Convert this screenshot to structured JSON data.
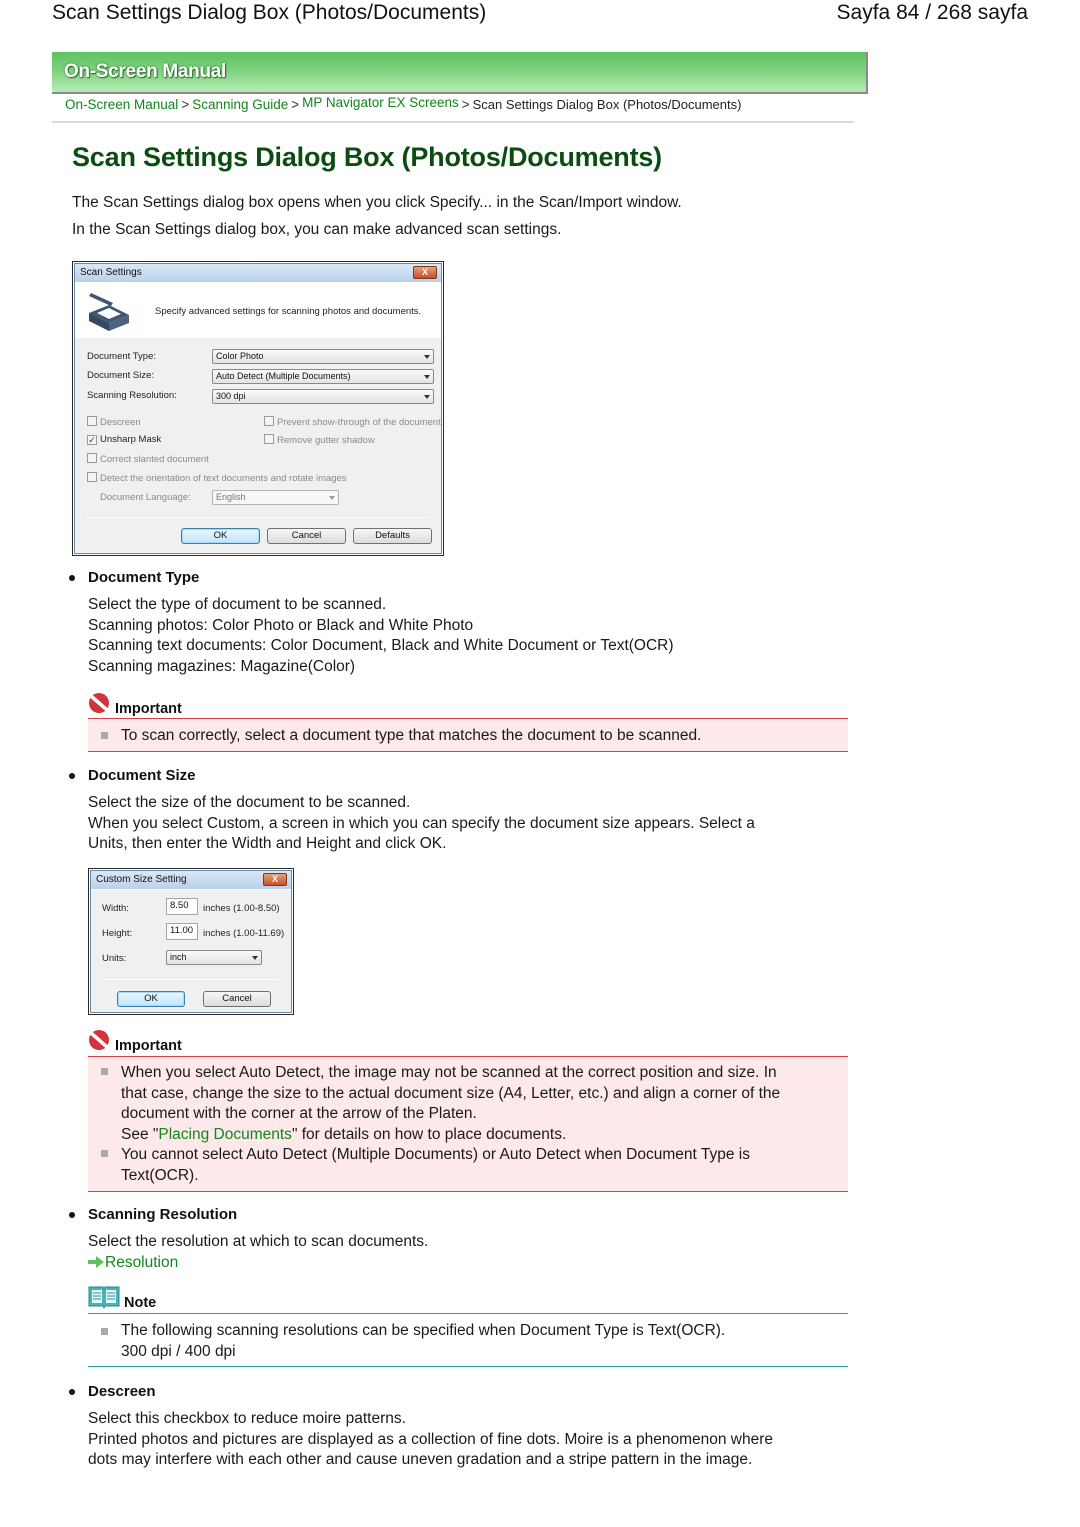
{
  "page_header": {
    "title": "Scan Settings Dialog Box (Photos/Documents)",
    "page_indicator": "Sayfa 84 / 268 sayfa"
  },
  "banner": {
    "label": "On-Screen Manual",
    "color": "#6bc96b"
  },
  "breadcrumb": {
    "items": [
      {
        "label": "On-Screen Manual",
        "link": true
      },
      {
        "label": "Scanning Guide",
        "link": true
      },
      {
        "label": "MP Navigator EX Screens",
        "link": true
      },
      {
        "label": "Scan Settings Dialog Box (Photos/Documents)",
        "link": false
      }
    ],
    "separator": ">"
  },
  "main": {
    "title": "Scan Settings Dialog Box (Photos/Documents)",
    "intro": [
      "The Scan Settings dialog box opens when you click Specify... in the Scan/Import window.",
      "In the Scan Settings dialog box, you can make advanced scan settings."
    ]
  },
  "scan_dialog": {
    "title": "Scan Settings",
    "close_label": "X",
    "description": "Specify advanced settings for scanning photos and documents.",
    "fields": [
      {
        "label": "Document Type:",
        "value": "Color Photo"
      },
      {
        "label": "Document Size:",
        "value": "Auto Detect (Multiple Documents)"
      },
      {
        "label": "Scanning Resolution:",
        "value": "300 dpi"
      }
    ],
    "checkboxes": [
      {
        "label": "Descreen",
        "checked": false,
        "mark": ""
      },
      {
        "label": "Prevent show-through of the document",
        "checked": false,
        "mark": ""
      },
      {
        "label": "Unsharp Mask",
        "checked": true,
        "mark": "✓"
      },
      {
        "label": "Remove gutter shadow",
        "checked": false,
        "mark": ""
      },
      {
        "label": "Correct slanted document",
        "checked": false,
        "mark": ""
      },
      {
        "label": "Detect the orientation of text documents and rotate images",
        "checked": false,
        "mark": ""
      }
    ],
    "language": {
      "label": "Document Language:",
      "value": "English"
    },
    "buttons": {
      "ok": "OK",
      "cancel": "Cancel",
      "defaults": "Defaults"
    }
  },
  "sections": {
    "document_type": {
      "heading": "Document Type",
      "lines": [
        "Select the type of document to be scanned.",
        "Scanning photos: Color Photo or Black and White Photo",
        "Scanning text documents: Color Document, Black and White Document or Text(OCR)",
        "Scanning magazines: Magazine(Color)"
      ],
      "important": {
        "title": "Important",
        "items": [
          "To scan correctly, select a document type that matches the document to be scanned."
        ]
      }
    },
    "document_size": {
      "heading": "Document Size",
      "lines": [
        "Select the size of the document to be scanned.",
        "When you select Custom, a screen in which you can specify the document size appears. Select a",
        "Units, then enter the Width and Height and click OK."
      ],
      "important": {
        "title": "Important",
        "item1_lines": [
          "When you select Auto Detect, the image may not be scanned at the correct position and size. In",
          "that case, change the size to the actual document size (A4, Letter, etc.) and align a corner of the",
          "document with the corner at the arrow of the Platen."
        ],
        "item1_see_prefix": "See \"",
        "item1_see_link": "Placing Documents",
        "item1_see_suffix": "\" for details on how to place documents.",
        "item2_lines": [
          "You cannot select Auto Detect (Multiple Documents) or Auto Detect when Document Type is",
          "Text(OCR)."
        ]
      }
    },
    "scanning_resolution": {
      "heading": "Scanning Resolution",
      "line": "Select the resolution at which to scan documents.",
      "link": "Resolution",
      "note": {
        "title": "Note",
        "lines": [
          "The following scanning resolutions can be specified when Document Type is Text(OCR).",
          "300 dpi / 400 dpi"
        ]
      }
    },
    "descreen": {
      "heading": "Descreen",
      "lines": [
        "Select this checkbox to reduce moire patterns.",
        "Printed photos and pictures are displayed as a collection of fine dots. Moire is a phenomenon where",
        "dots may interfere with each other and cause uneven gradation and a stripe pattern in the image."
      ]
    }
  },
  "custom_dialog": {
    "title": "Custom Size Setting",
    "close_label": "X",
    "width": {
      "label": "Width:",
      "value": "8.50",
      "range": "inches (1.00-8.50)"
    },
    "height": {
      "label": "Height:",
      "value": "11.00",
      "range": "inches (1.00-11.69)"
    },
    "units": {
      "label": "Units:",
      "value": "inch"
    },
    "buttons": {
      "ok": "OK",
      "cancel": "Cancel"
    }
  },
  "colors": {
    "title_green": "#0b4d11",
    "link_green": "#11861b",
    "important_red": "#d6404a",
    "important_bg": "#fde8ea",
    "note_teal": "#2b9aa4"
  }
}
